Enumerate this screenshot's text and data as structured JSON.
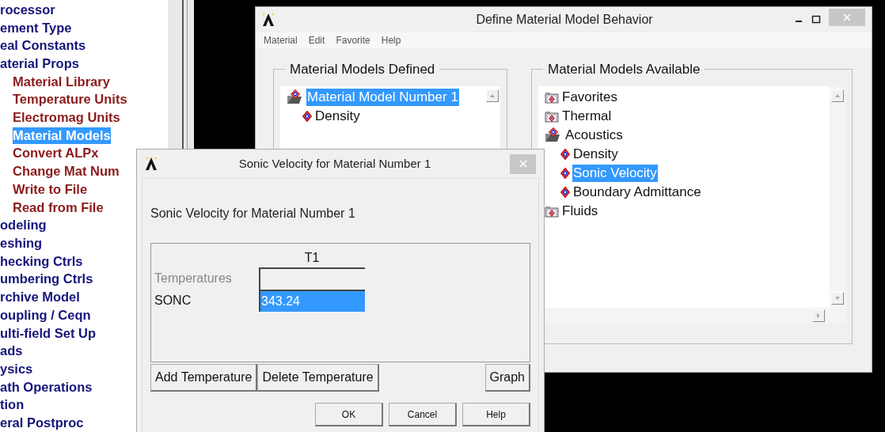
{
  "sidebar": {
    "items": [
      {
        "label": "rocessor",
        "selected": false
      },
      {
        "label": "ement Type",
        "selected": false
      },
      {
        "label": "eal Constants",
        "selected": false
      },
      {
        "label": "aterial Props",
        "selected": false,
        "children": [
          {
            "label": "Material Library",
            "selected": false
          },
          {
            "label": "Temperature Units",
            "selected": false
          },
          {
            "label": "Electromag Units",
            "selected": false
          },
          {
            "label": "Material Models",
            "selected": true
          },
          {
            "label": "Convert ALPx",
            "selected": false
          },
          {
            "label": "Change Mat Num",
            "selected": false
          },
          {
            "label": "Write to File",
            "selected": false
          },
          {
            "label": "Read from File",
            "selected": false
          }
        ]
      },
      {
        "label": "odeling",
        "selected": false
      },
      {
        "label": "eshing",
        "selected": false
      },
      {
        "label": "hecking Ctrls",
        "selected": false
      },
      {
        "label": "umbering Ctrls",
        "selected": false
      },
      {
        "label": "rchive Model",
        "selected": false
      },
      {
        "label": "oupling / Ceqn",
        "selected": false
      },
      {
        "label": "ulti-field Set Up",
        "selected": false
      },
      {
        "label": "ads",
        "selected": false
      },
      {
        "label": "ysics",
        "selected": false
      },
      {
        "label": "ath Operations",
        "selected": false
      },
      {
        "label": "tion",
        "selected": false
      },
      {
        "label": "eral Postproc",
        "selected": false
      }
    ]
  },
  "material_window": {
    "title": "Define Material Model Behavior",
    "menu": [
      "Material",
      "Edit",
      "Favorite",
      "Help"
    ],
    "defined": {
      "title": "Material Models Defined",
      "tree": [
        {
          "label": "Material Model Number 1",
          "selected": true,
          "expanded": true,
          "children": [
            {
              "label": "Density",
              "selected": false
            }
          ]
        }
      ]
    },
    "available": {
      "title": "Material Models Available",
      "tree": [
        {
          "label": "Favorites",
          "selected": false,
          "expanded": false
        },
        {
          "label": "Thermal",
          "selected": false,
          "expanded": false
        },
        {
          "label": "Acoustics",
          "selected": false,
          "expanded": true,
          "children": [
            {
              "label": "Density",
              "selected": false
            },
            {
              "label": "Sonic Velocity",
              "selected": true
            },
            {
              "label": "Boundary Admittance",
              "selected": false
            }
          ]
        },
        {
          "label": "Fluids",
          "selected": false,
          "expanded": false
        }
      ]
    }
  },
  "sonic_dialog": {
    "title": "Sonic Velocity for Material Number 1",
    "heading": "Sonic Velocity for Material Number 1",
    "column": "T1",
    "rows": [
      {
        "label": "Temperatures",
        "disabled": true,
        "selected": false
      },
      {
        "label": "SONC",
        "value": "343.24",
        "disabled": false,
        "selected": true
      }
    ],
    "buttons": [
      "Add Temperature",
      "Delete Temperature",
      "Graph"
    ],
    "footer_buttons": [
      "OK",
      "Cancel",
      "Help"
    ]
  }
}
